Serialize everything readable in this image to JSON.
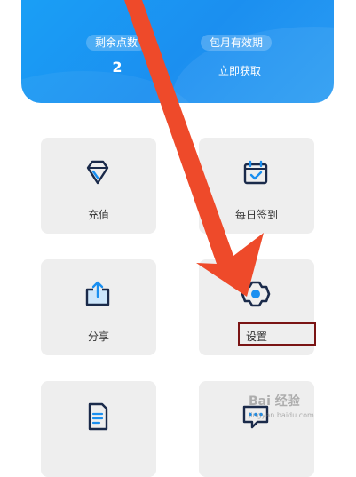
{
  "account": {
    "points_label": "剩余点数",
    "points_value": "2",
    "monthly_label": "包月有效期",
    "get_link": "立即获取"
  },
  "tiles": [
    {
      "label": "充值",
      "icon": "diamond-icon"
    },
    {
      "label": "每日签到",
      "icon": "calendar-check-icon"
    },
    {
      "label": "分享",
      "icon": "share-upload-icon"
    },
    {
      "label": "设置",
      "icon": "gear-icon"
    },
    {
      "label": "",
      "icon": "document-icon"
    },
    {
      "label": "",
      "icon": "chat-bubble-icon"
    }
  ],
  "watermark": {
    "text": "Bai 经验",
    "url": "jingyan.baidu.com"
  },
  "colors": {
    "banner": "#1b8ff0",
    "tile_bg": "#eeeeee",
    "icon_stroke": "#1a2a4a",
    "icon_accent": "#1a8ff0",
    "arrow": "#ee4a2a",
    "highlight": "#7a1414"
  }
}
